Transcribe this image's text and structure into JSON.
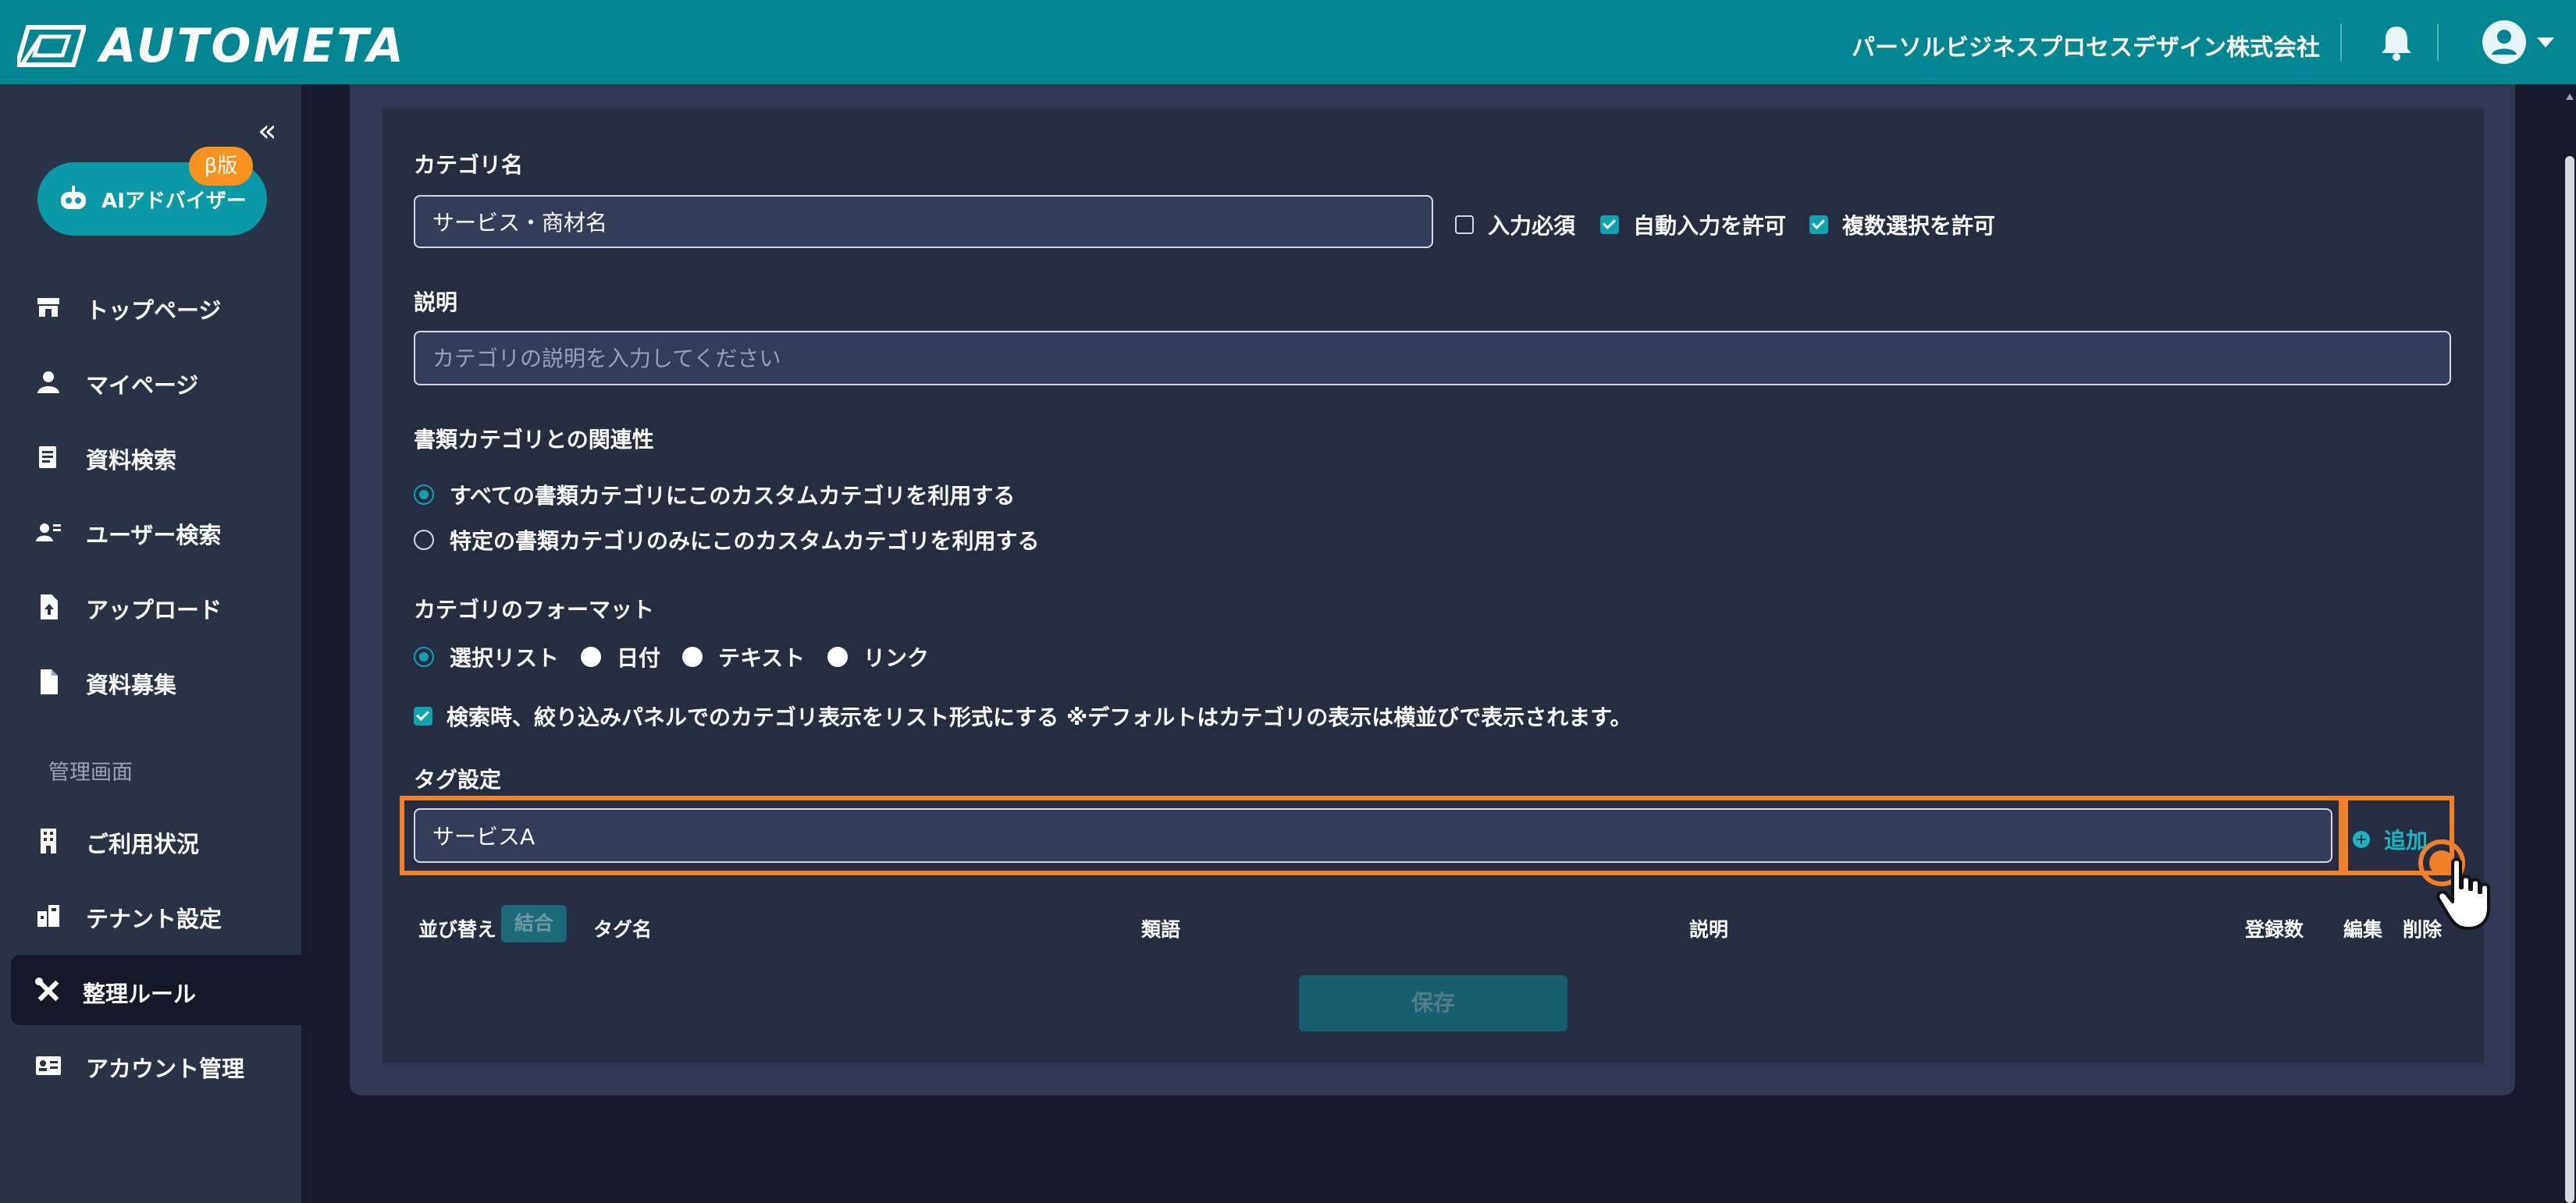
{
  "header": {
    "logo_text": "AUTOMETA",
    "company_name": "パーソルビジネスプロセスデザイン株式会社"
  },
  "sidebar": {
    "ai_button_label": "AIアドバイザー",
    "beta_badge": "β版",
    "items": [
      {
        "label": "トップページ",
        "icon": "store-icon"
      },
      {
        "label": "マイページ",
        "icon": "person-icon"
      },
      {
        "label": "資料検索",
        "icon": "document-search-icon"
      },
      {
        "label": "ユーザー検索",
        "icon": "user-search-icon"
      },
      {
        "label": "アップロード",
        "icon": "upload-file-icon"
      },
      {
        "label": "資料募集",
        "icon": "file-icon"
      }
    ],
    "admin_section_label": "管理画面",
    "admin_items": [
      {
        "label": "ご利用状況",
        "icon": "building-icon"
      },
      {
        "label": "テナント設定",
        "icon": "tenant-icon"
      },
      {
        "label": "整理ルール",
        "icon": "tools-icon",
        "active": true
      },
      {
        "label": "アカウント管理",
        "icon": "account-card-icon"
      }
    ]
  },
  "form": {
    "category_name_label": "カテゴリ名",
    "category_name_value": "サービス・商材名",
    "required_label": "入力必須",
    "required_checked": false,
    "auto_input_label": "自動入力を許可",
    "auto_input_checked": true,
    "multi_select_label": "複数選択を許可",
    "multi_select_checked": true,
    "description_label": "説明",
    "description_placeholder": "カテゴリの説明を入力してください",
    "relation_label": "書類カテゴリとの関連性",
    "relation_options": [
      {
        "label": "すべての書類カテゴリにこのカスタムカテゴリを利用する",
        "selected": true
      },
      {
        "label": "特定の書類カテゴリのみにこのカスタムカテゴリを利用する",
        "selected": false
      }
    ],
    "format_label": "カテゴリのフォーマット",
    "format_options": [
      {
        "label": "選択リスト",
        "selected": true
      },
      {
        "label": "日付",
        "selected": false
      },
      {
        "label": "テキスト",
        "selected": false
      },
      {
        "label": "リンク",
        "selected": false
      }
    ],
    "list_display_label": "検索時、絞り込みパネルでのカテゴリ表示をリスト形式にする ※デフォルトはカテゴリの表示は横並びで表示されます。",
    "list_display_checked": true,
    "tag_settings_label": "タグ設定",
    "tag_input_value": "サービスA",
    "add_button_label": "追加"
  },
  "table": {
    "sort_label": "並び替え",
    "merge_button": "結合",
    "columns": {
      "tag_name": "タグ名",
      "synonyms": "類語",
      "description": "説明",
      "count": "登録数",
      "edit": "編集",
      "delete": "削除"
    }
  },
  "save_button_label": "保存",
  "colors": {
    "header": "#038694",
    "accent": "#0fa3b1",
    "highlight": "#f0802a",
    "beta": "#f7921e"
  }
}
